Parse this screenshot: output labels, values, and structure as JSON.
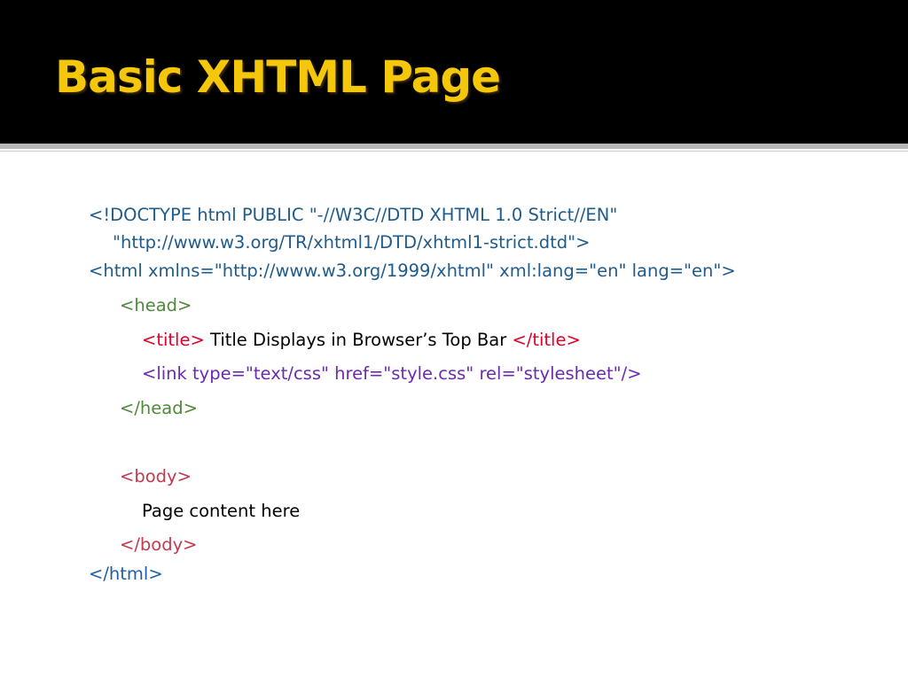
{
  "slide": {
    "title": "Basic XHTML Page"
  },
  "code": {
    "doctype_line1": "<!DOCTYPE html PUBLIC \"-//W3C//DTD XHTML 1.0 Strict//EN\"",
    "doctype_line2": "\"http://www.w3.org/TR/xhtml1/DTD/xhtml1-strict.dtd\">",
    "html_open": "<html xmlns=\"http://www.w3.org/1999/xhtml\" xml:lang=\"en\" lang=\"en\">",
    "head_open": "<head>",
    "title_open": "<title>",
    "title_text": " Title Displays in Browser’s Top Bar ",
    "title_close": "</title>",
    "link_tag": "<link type=\"text/css\" href=\"style.css\" rel=\"stylesheet\"/>",
    "head_close": "</head>",
    "body_open": "<body>",
    "body_text": "Page content here",
    "body_close": "</body>",
    "html_close": "</html>"
  },
  "colors": {
    "title_bar": "#000000",
    "title_text": "#f5c70a",
    "doctype_html": "#1f5b8b",
    "head": "#4e8a3a",
    "title_tag": "#e0002a",
    "link_tag": "#6a2bb0",
    "body_tag": "#c23a4e",
    "content": "#000000"
  }
}
